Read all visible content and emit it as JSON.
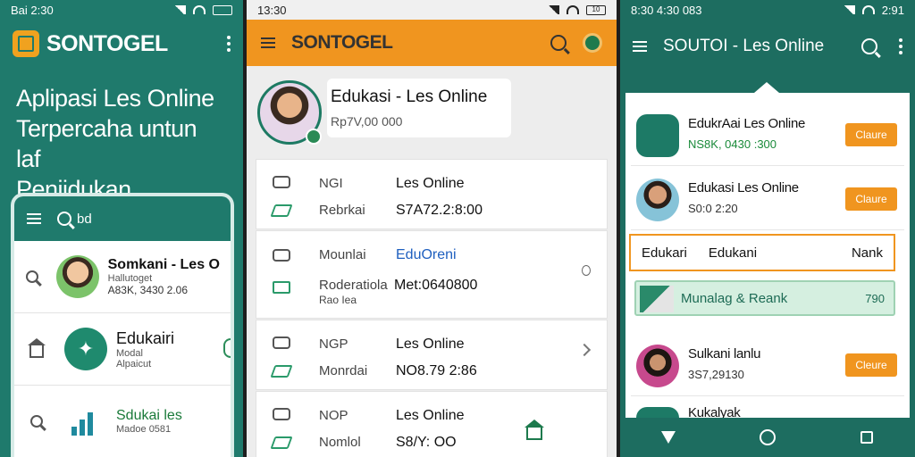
{
  "panel1": {
    "status_time": "Bai 2:30",
    "brand": "SONTOGEL",
    "hero": [
      "Aplipasi Les Online",
      "Terpercaha untun laf",
      "Peniidukan"
    ],
    "searchbar_text": "bd",
    "rows": [
      {
        "title": "Somkani - Les O",
        "sub": "Hallutoget",
        "value": "A83K, 3430 2.06"
      },
      {
        "title": "Edukairi",
        "sub": "Modal",
        "value": "Alpaicut"
      },
      {
        "title": "Sdukai les",
        "sub": "Madoe 0581",
        "value": ""
      }
    ]
  },
  "panel2": {
    "status_time": "13:30",
    "battery": "10",
    "brand": "SONTOGEL",
    "profile_name": "Edukasi - Les Online",
    "profile_value": "Rp7V,00 000",
    "rows": [
      {
        "label1": "NGI",
        "value1": "Les Online",
        "label2": "Rebrkai",
        "value2": "S7A72.2:8:00"
      },
      {
        "label1": "Mounlai",
        "value1": "EduOreni",
        "label2": "Roderatiola",
        "label3": "Rao Iea",
        "value2": "Met:0640800"
      },
      {
        "label1": "NGP",
        "value1": "Les Online",
        "label2": "Monrdai",
        "value2": "NO8.79 2:86"
      },
      {
        "label1": "NOP",
        "value1": "Les Online",
        "label2": "Nomlol",
        "value2": "S8/Y: OO"
      }
    ]
  },
  "panel3": {
    "status_time": "8:30 4:30 083",
    "status_right": "2:91",
    "title": "SOUTOI - Les Online",
    "rows": [
      {
        "name": "EdukrAai Les Online",
        "sub": "NS8K, 0430 :300",
        "button": "Claure"
      },
      {
        "name": "Edukasi Les Online",
        "sub": "S0:0 2:20",
        "button": "Claure"
      },
      {
        "name": "Sulkani lanlu",
        "sub": "3S7,29130",
        "button": "Cleure"
      },
      {
        "name": "Kukalyak",
        "sub": "",
        "button": ""
      }
    ],
    "tabs": [
      "Edukari",
      "Edukani",
      "Nank"
    ],
    "banner_text": "Munalag & Reank",
    "banner_value": "790"
  }
}
